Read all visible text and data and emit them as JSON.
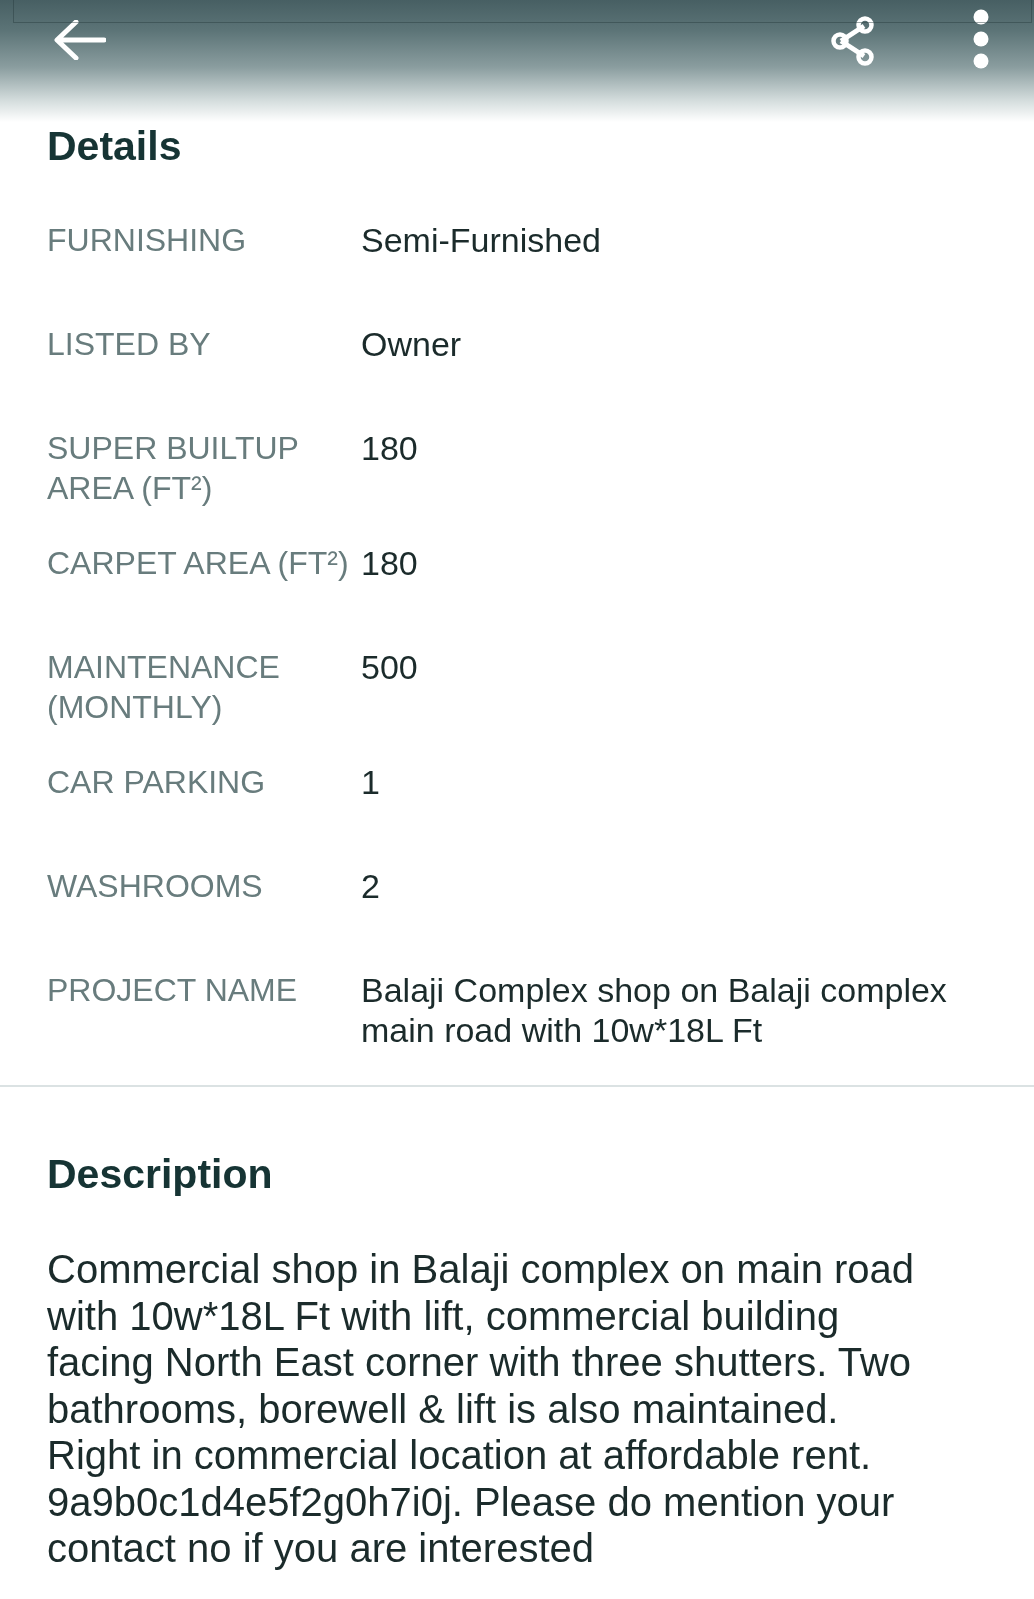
{
  "details": {
    "heading": "Details",
    "rows": [
      {
        "label": "FURNISHING",
        "value": "Semi-Furnished"
      },
      {
        "label": "LISTED BY",
        "value": "Owner"
      },
      {
        "label": "SUPER BUILTUP AREA (FT²)",
        "value": "180"
      },
      {
        "label": "CARPET AREA (FT²)",
        "value": "180"
      },
      {
        "label": "MAINTENANCE (MONTHLY)",
        "value": "500"
      },
      {
        "label": "CAR PARKING",
        "value": "1"
      },
      {
        "label": "WASHROOMS",
        "value": "2"
      },
      {
        "label": "PROJECT NAME",
        "value": "Balaji Complex shop on Balaji complex main road with 10w*18L Ft"
      }
    ]
  },
  "description": {
    "heading": "Description",
    "text": "Commercial shop in Balaji complex on main road with 10w*18L Ft with lift, commercial building facing North East corner with three shutters. Two bathrooms, borewell & lift is also maintained. Right in commercial location at affordable rent. 9a9b0c1d4e5f2g0h7i0j. Please do mention your contact no if you are interested"
  }
}
